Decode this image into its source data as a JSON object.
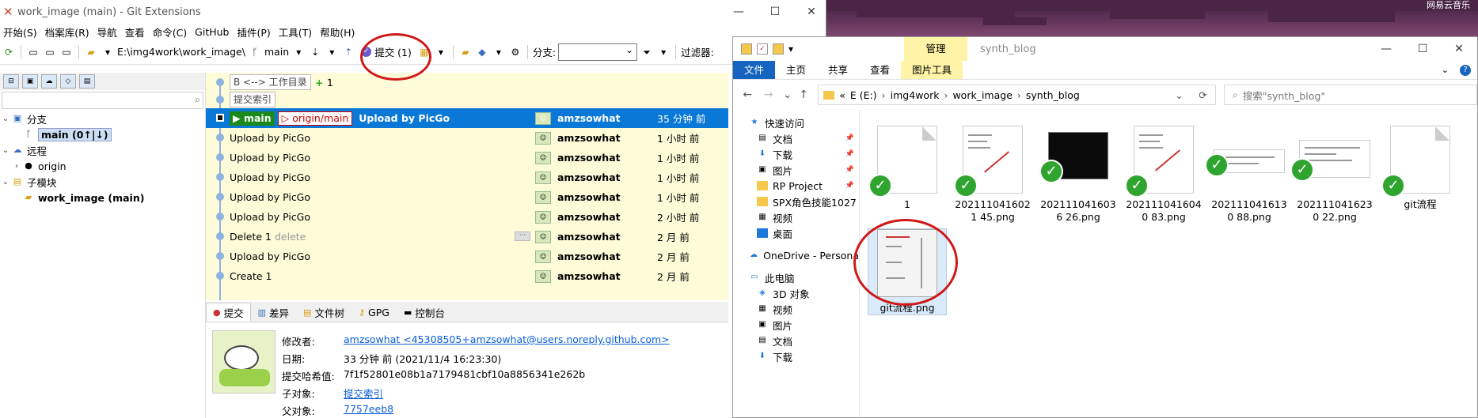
{
  "git": {
    "window_title": "work_image (main) - Git Extensions",
    "menu": [
      "开始(S)",
      "档案库(R)",
      "导航",
      "查看",
      "命令(C)",
      "GitHub",
      "插件(P)",
      "工具(T)",
      "帮助(H)"
    ],
    "toolbar": {
      "path": "E:\\img4work\\work_image\\",
      "branch": "main",
      "commit_label": "提交 (1)",
      "branch_label": "分支:",
      "filter_label": "过滤器:"
    },
    "tree": {
      "branches_label": "分支",
      "current_branch": "main (0↑|↓)",
      "remotes_label": "远程",
      "origin": "origin",
      "submodules_label": "子模块",
      "submodule": "work_image (main)"
    },
    "graph": {
      "worktree": "B <--> 工作目录",
      "plus_one": "+",
      "plus_count": "1",
      "index": "提交索引",
      "commits": [
        {
          "branch": "main",
          "remote": "origin/main",
          "msg": "Upload by PicGo",
          "extra": "",
          "author": "amzsowhat",
          "date": "35 分钟 前"
        },
        {
          "msg": "Upload by PicGo",
          "extra": "",
          "author": "amzsowhat",
          "date": "1 小时 前"
        },
        {
          "msg": "Upload by PicGo",
          "extra": "",
          "author": "amzsowhat",
          "date": "1 小时 前"
        },
        {
          "msg": "Upload by PicGo",
          "extra": "",
          "author": "amzsowhat",
          "date": "1 小时 前"
        },
        {
          "msg": "Upload by PicGo",
          "extra": "",
          "author": "amzsowhat",
          "date": "1 小时 前"
        },
        {
          "msg": "Upload by PicGo",
          "extra": "",
          "author": "amzsowhat",
          "date": "2 小时 前"
        },
        {
          "msg": "Delete 1",
          "extra": "delete",
          "author": "amzsowhat",
          "date": "2 月 前"
        },
        {
          "msg": "Upload by PicGo",
          "extra": "",
          "author": "amzsowhat",
          "date": "2 月 前"
        },
        {
          "msg": "Create   1",
          "extra": "",
          "author": "amzsowhat",
          "date": "2 月 前"
        }
      ],
      "more_marker": "···"
    },
    "detail_tabs": [
      "提交",
      "差异",
      "文件树",
      "GPG",
      "控制台"
    ],
    "detail": {
      "author_k": "修改者:",
      "author_v": "amzsowhat <45308505+amzsowhat@users.noreply.github.com>",
      "date_k": "日期:",
      "date_v": "33 分钟 前 (2021/11/4 16:23:30)",
      "hash_k": "提交哈希值:",
      "hash_v": "7f1f52801e08b1a7179481cbf10a8856341e262b",
      "child_k": "子对象:",
      "child_v": "提交索引",
      "parent_k": "父对象:",
      "parent_v": "7757eeb8"
    }
  },
  "explorer": {
    "manage_tab": "管理",
    "title": "synth_blog",
    "ribbon": [
      "文件",
      "主页",
      "共享",
      "查看",
      "图片工具"
    ],
    "address": {
      "prefix": "«",
      "drive": "E (E:)",
      "p1": "img4work",
      "p2": "work_image",
      "p3": "synth_blog"
    },
    "search_placeholder": "搜索\"synth_blog\"",
    "nav": [
      {
        "label": "快速访问",
        "icon": "star",
        "top": true
      },
      {
        "label": "文档",
        "icon": "doc",
        "pin": true
      },
      {
        "label": "下载",
        "icon": "down",
        "pin": true
      },
      {
        "label": "图片",
        "icon": "pic",
        "pin": true
      },
      {
        "label": "RP Project",
        "icon": "folder",
        "pin": true
      },
      {
        "label": "SPX角色技能1027",
        "icon": "folder"
      },
      {
        "label": "视频",
        "icon": "video"
      },
      {
        "label": "桌面",
        "icon": "desk"
      },
      {
        "label": "OneDrive - Persona",
        "icon": "cloud",
        "top": true
      },
      {
        "label": "此电脑",
        "icon": "pc",
        "top": true
      },
      {
        "label": "3D 对象",
        "icon": "3d"
      },
      {
        "label": "视频",
        "icon": "video"
      },
      {
        "label": "图片",
        "icon": "pic"
      },
      {
        "label": "文档",
        "icon": "doc"
      },
      {
        "label": "下载",
        "icon": "down"
      }
    ],
    "files": [
      {
        "name": "1",
        "kind": "doc"
      },
      {
        "name": "2021110416021 45.png",
        "kind": "shot"
      },
      {
        "name": "2021110416036 26.png",
        "kind": "dark"
      },
      {
        "name": "2021110416040 83.png",
        "kind": "shot"
      },
      {
        "name": "2021110416130 88.png",
        "kind": "wide"
      },
      {
        "name": "2021110416230 22.png",
        "kind": "wide2"
      },
      {
        "name": "git流程",
        "kind": "doc"
      },
      {
        "name": "git流程.png",
        "kind": "flow"
      }
    ]
  },
  "desktop_label": "网易云音乐",
  "colors": {
    "accent": "#0a78d7",
    "graph_bg": "#fdfbd8",
    "annotation": "#d01818",
    "branch": "#1a8a1a"
  }
}
